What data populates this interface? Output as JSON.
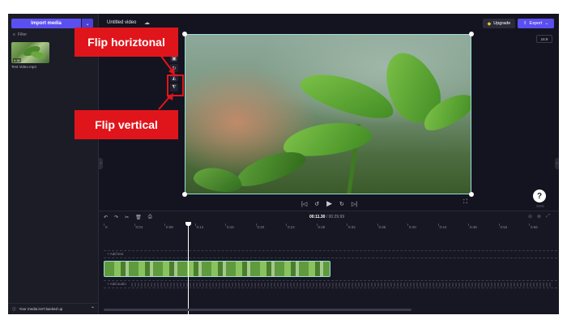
{
  "sidebar": {
    "import_label": "Import media",
    "filter_label": "Filter",
    "media": [
      {
        "name": "Test Video.mp4",
        "duration": "0:30"
      }
    ],
    "backup_text": "Your media isn't backed up"
  },
  "header": {
    "project_title": "Untitled video",
    "upgrade_label": "Upgrade",
    "export_label": "Export",
    "aspect_ratio": "16:9"
  },
  "timeline": {
    "current_time": "00:11.30",
    "total_time": "/ 00:29.99",
    "ticks": [
      "0",
      "0:04",
      "0:08",
      "0:12",
      "0:16",
      "0:20",
      "0:24",
      "0:28",
      "0:32",
      "0:36",
      "0:40",
      "0:44",
      "0:48",
      "0:52",
      "0:56"
    ],
    "add_text_label": "+ Add text",
    "add_audio_label": "+ Add audio"
  },
  "annotations": {
    "flip_horizontal": "Flip horiztonal",
    "flip_vertical": "Flip vertical",
    "color": "#e0151c"
  },
  "colors": {
    "accent": "#5a4ff0",
    "selection": "#9be0d6",
    "background": "#141420"
  }
}
